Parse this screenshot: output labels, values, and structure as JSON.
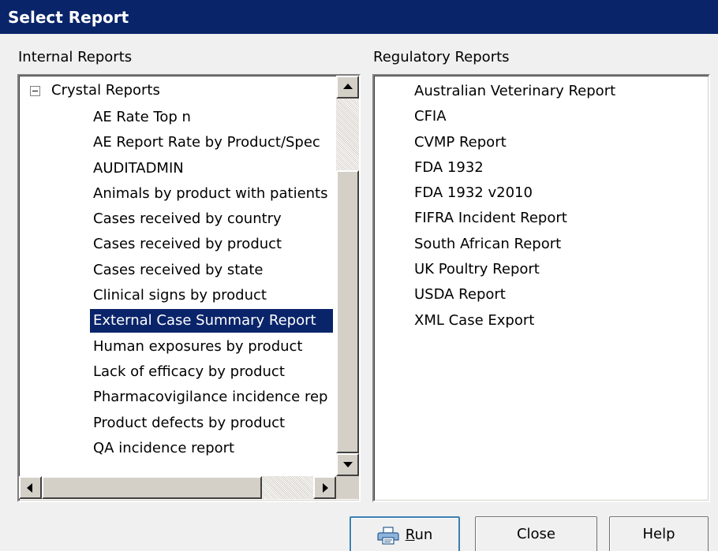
{
  "window": {
    "title": "Select Report"
  },
  "internal": {
    "label": "Internal Reports",
    "root": "Crystal Reports",
    "items": [
      "AE Rate Top n",
      "AE Report Rate by Product/Spec",
      "AUDITADMIN",
      "Animals by product with patients",
      "Cases received by country",
      "Cases received by product",
      "Cases received by state",
      "Clinical signs by product",
      "External Case Summary Report",
      "Human exposures by product",
      "Lack of efficacy by product",
      "Pharmacovigilance incidence rep",
      "Product defects by product",
      "QA incidence report"
    ],
    "selected_index": 8
  },
  "regulatory": {
    "label": "Regulatory Reports",
    "items": [
      "Australian Veterinary Report",
      "CFIA",
      "CVMP Report",
      "FDA 1932",
      "FDA 1932 v2010",
      "FIFRA Incident Report",
      "South African Report",
      "UK Poultry Report",
      "USDA Report",
      "XML Case Export"
    ]
  },
  "buttons": {
    "run_prefix": "",
    "run_mnemonic": "R",
    "run_rest": "un",
    "close": "Close",
    "help": "Help"
  },
  "icons": {
    "run": "printer-icon",
    "expander": "collapse-minus-icon"
  }
}
